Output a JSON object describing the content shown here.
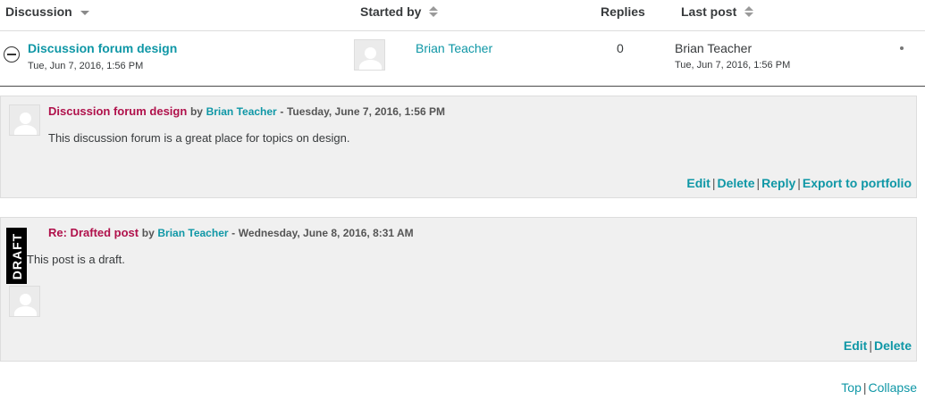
{
  "header": {
    "discussion": "Discussion",
    "started_by": "Started by",
    "replies": "Replies",
    "last_post": "Last post"
  },
  "discussion_row": {
    "subject": "Discussion forum design",
    "created": "Tue, Jun 7, 2016, 1:56 PM",
    "started_by": "Brian Teacher",
    "replies": "0",
    "last_post_author": "Brian Teacher",
    "last_post_date": "Tue, Jun 7, 2016, 1:56 PM"
  },
  "posts": [
    {
      "subject": "Discussion forum design",
      "by": "by",
      "author": "Brian Teacher",
      "separator": "-",
      "date": "Tuesday, June 7, 2016, 1:56 PM",
      "content": "This discussion forum is a great place for topics on design.",
      "commands": [
        "Edit",
        "Delete",
        "Reply",
        "Export to portfolio"
      ]
    },
    {
      "badge": "DRAFT",
      "subject": "Re: Drafted post",
      "by": "by",
      "author": "Brian Teacher",
      "separator": "-",
      "date": "Wednesday, June 8, 2016, 8:31 AM",
      "content": "This post is a draft.",
      "commands": [
        "Edit",
        "Delete"
      ]
    }
  ],
  "footer": {
    "top": "Top",
    "collapse": "Collapse"
  },
  "command_separator": "|",
  "colors": {
    "link": "#0f97a6",
    "subject": "#b0114b",
    "post_bg": "#f0f0f0"
  }
}
